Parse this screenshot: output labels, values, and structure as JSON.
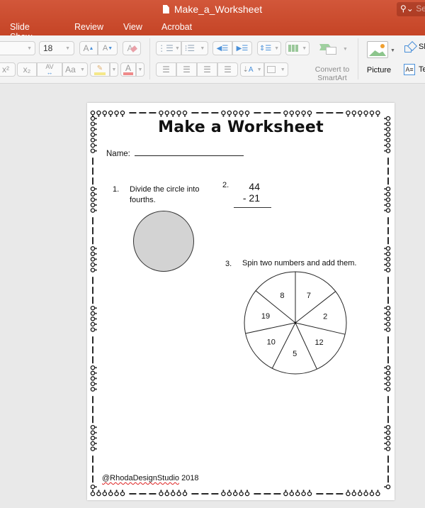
{
  "app": {
    "window_title": "Make_a_Worksheet",
    "search_placeholder": "Sea",
    "menu_tabs": [
      "Slide Show",
      "Review",
      "View",
      "Acrobat"
    ]
  },
  "ribbon": {
    "font_size": "18",
    "increase_font": "A",
    "decrease_font": "A",
    "superscript": "x²",
    "subscript": "x₂",
    "char_spacing": "AV",
    "change_case": "Aa",
    "font_color_letter": "A",
    "convert_smartart_label": "Convert to SmartArt",
    "picture_label": "Picture",
    "shapes_label": "Sh",
    "textbox_label": "Te",
    "colors": {
      "highlight": "#f5e88a",
      "font_color": "#ef8a8a",
      "accent_blue": "#4a90d9"
    }
  },
  "worksheet": {
    "title": "Make a Worksheet",
    "name_label": "Name:",
    "questions": [
      {
        "number": "1.",
        "text": "Divide the circle into fourths."
      },
      {
        "number": "2.",
        "top": "44",
        "bottom": "- 21"
      },
      {
        "number": "3.",
        "text": "Spin two numbers and add them."
      }
    ],
    "circle_fill": "#d3d3d3",
    "spinner_numbers": [
      "7",
      "2",
      "12",
      "5",
      "10",
      "19",
      "8"
    ],
    "footer_brand": "@RhodaDesignStudio",
    "footer_year": "2018"
  }
}
